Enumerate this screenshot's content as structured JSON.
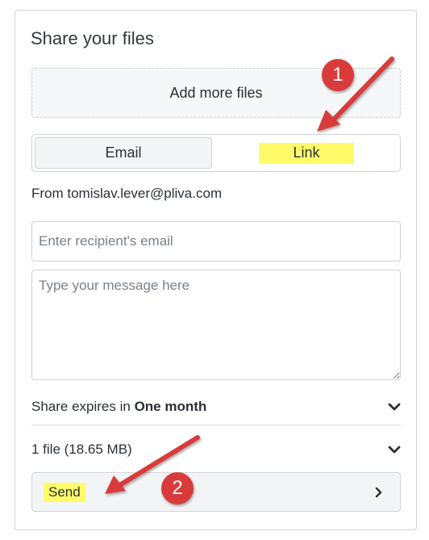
{
  "panel": {
    "title": "Share your files",
    "dropzone_label": "Add more files",
    "tabs": [
      {
        "label": "Email"
      },
      {
        "label": "Link"
      }
    ],
    "from_text": "From tomislav.lever@pliva.com",
    "recipient_placeholder": "Enter recipient's email",
    "message_placeholder": "Type your message here",
    "expires_prefix": "Share expires in ",
    "expires_value": "One month",
    "files_summary": "1 file (18.65 MB)",
    "send_label": "Send"
  },
  "annotations": {
    "badge_1": "1",
    "badge_2": "2",
    "highlight_color": "#fdfb6a",
    "arrow_color": "#d93b3b"
  },
  "icons": {
    "expires_chevron": "chevron-down-icon",
    "files_chevron": "chevron-down-icon",
    "send_chevron": "chevron-right-icon"
  }
}
